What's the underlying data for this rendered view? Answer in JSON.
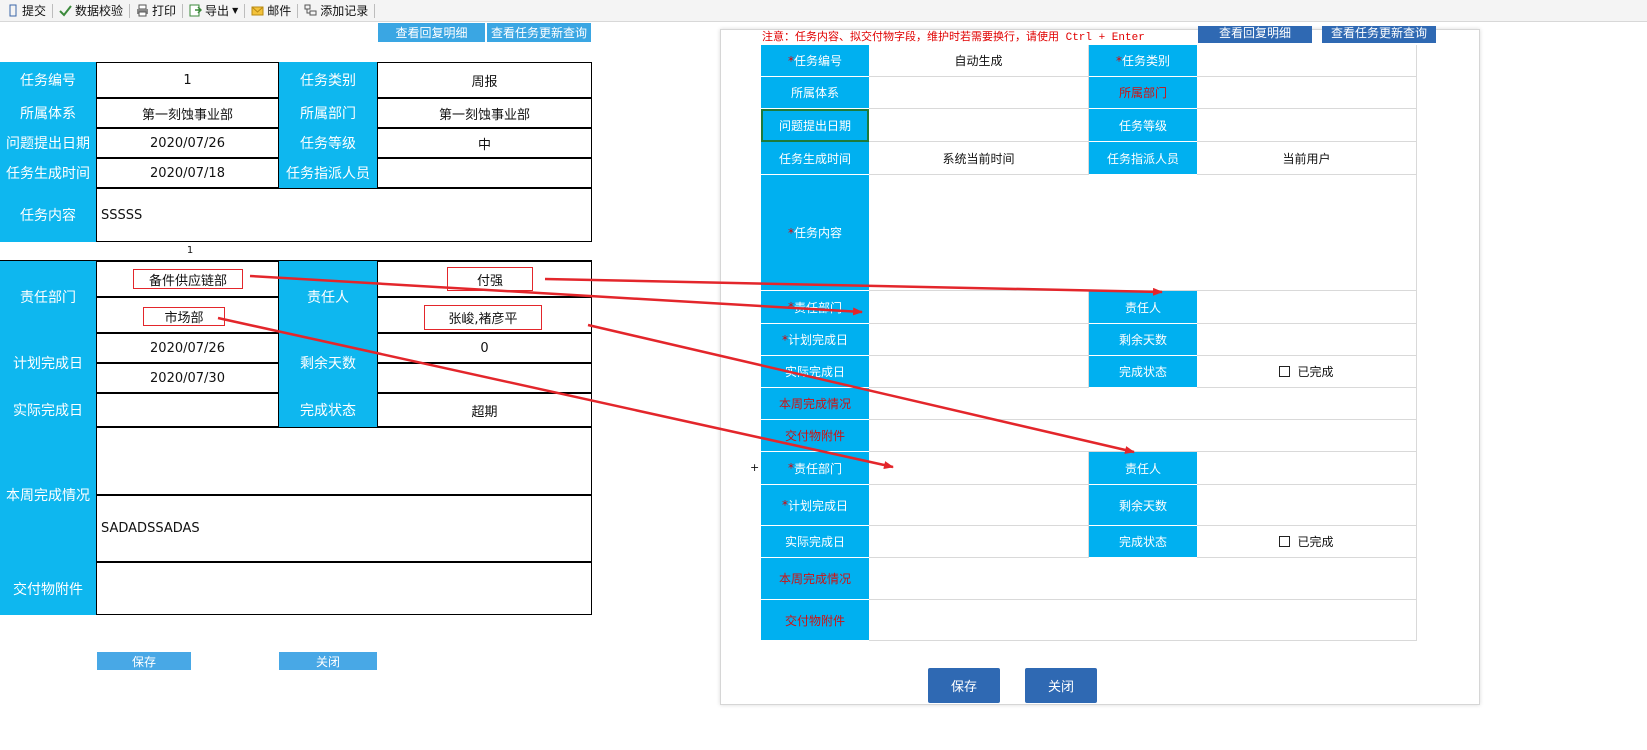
{
  "toolbar": {
    "items": [
      {
        "label": "提交",
        "icon": "submit-icon"
      },
      {
        "label": "数据校验",
        "icon": "validate-icon"
      },
      {
        "label": "打印",
        "icon": "print-icon"
      },
      {
        "label": "导出",
        "icon": "export-icon"
      },
      {
        "label": "邮件",
        "icon": "mail-icon"
      },
      {
        "label": "添加记录",
        "icon": "add-record-icon"
      }
    ]
  },
  "left_form": {
    "top_buttons": [
      "查看回复明细",
      "查看任务更新查询"
    ],
    "task_no_label": "任务编号",
    "task_no_value": "1",
    "task_type_label": "任务类别",
    "task_type_value": "周报",
    "system_label": "所属体系",
    "system_value": "第一刻蚀事业部",
    "dept_label": "所属部门",
    "dept_value": "第一刻蚀事业部",
    "issue_date_label": "问题提出日期",
    "issue_date_value": "2020/07/26",
    "task_level_label": "任务等级",
    "task_level_value": "中",
    "gen_time_label": "任务生成时间",
    "gen_time_value": "2020/07/18",
    "assigner_label": "任务指派人员",
    "assigner_value": "",
    "content_label": "任务内容",
    "content_value": "SSSSS",
    "sep_number": "1",
    "resp_dept_label": "责任部门",
    "resp_dept_1": "备件供应链部",
    "resp_dept_2": "市场部",
    "resp_person_label": "责任人",
    "resp_person_1": "付强",
    "resp_person_2": "张峻,褚彦平",
    "plan_date_label": "计划完成日",
    "plan_date_1": "2020/07/26",
    "plan_date_2": "2020/07/30",
    "remain_label": "剩余天数",
    "remain_1": "0",
    "remain_2": "",
    "actual_label": "实际完成日",
    "actual_value": "",
    "status_label": "完成状态",
    "status_value": "超期",
    "weekly_label": "本周完成情况",
    "weekly_value": "SADADSSADAS",
    "deliverable_label": "交付物附件",
    "deliverable_value": "",
    "save": "保存",
    "close": "关闭"
  },
  "right_form": {
    "notice": "注意：任务内容、拟交付物字段，维护时若需要换行，请使用 Ctrl + Enter",
    "top_buttons": [
      "查看回复明细",
      "查看任务更新查询"
    ],
    "required_star": "*",
    "task_no_label": "任务编号",
    "task_no_value": "自动生成",
    "task_type_label": "任务类别",
    "task_type_value": "",
    "system_label": "所属体系",
    "dept_label": "所属部门",
    "issue_date_label": "问题提出日期",
    "task_level_label": "任务等级",
    "gen_time_label": "任务生成时间",
    "gen_time_value": "系统当前时间",
    "assigner_label": "任务指派人员",
    "assigner_value": "当前用户",
    "content_label": "任务内容",
    "resp_dept_label": "责任部门",
    "resp_person_label": "责任人",
    "plan_date_label": "计划完成日",
    "remain_label": "剩余天数",
    "actual_label": "实际完成日",
    "status_label": "完成状态",
    "status_value": "已完成",
    "weekly_label": "本周完成情况",
    "deliverable_label": "交付物附件",
    "plus": "+",
    "save": "保存",
    "close": "关闭"
  },
  "colors": {
    "label_bg": "#0eb7ef",
    "arrow": "#e3262b",
    "button_dark": "#2f69b3"
  }
}
